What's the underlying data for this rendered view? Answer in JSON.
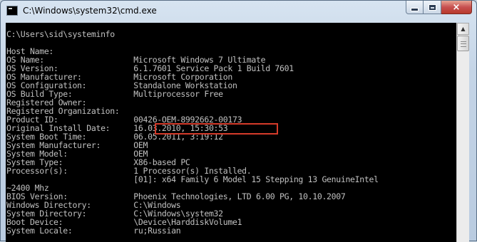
{
  "window": {
    "title": "C:\\Windows\\system32\\cmd.exe",
    "controls": {
      "minimize": "minimize",
      "maximize": "maximize",
      "close": "×"
    }
  },
  "console": {
    "lines": [
      "C:\\Users\\sid\\systeminfo",
      "",
      "Host Name:",
      "OS Name:                   Microsoft Windows 7 Ultimate",
      "OS Version:                6.1.7601 Service Pack 1 Build 7601",
      "OS Manufacturer:           Microsoft Corporation",
      "OS Configuration:          Standalone Workstation",
      "OS Build Type:             Multiprocessor Free",
      "Registered Owner:",
      "Registered Organization:",
      "Product ID:                00426-OEM-8992662-00173",
      "Original Install Date:     16.03.2010, 15:30:53",
      "System Boot Time:          06.05.2011, 3:19:12",
      "System Manufacturer:       OEM",
      "System Model:              OEM",
      "System Type:               X86-based PC",
      "Processor(s):              1 Processor(s) Installed.",
      "                           [01]: x64 Family 6 Model 15 Stepping 13 GenuineIntel",
      "~2400 Mhz",
      "BIOS Version:              Phoenix Technologies, LTD 6.00 PG, 10.10.2007",
      "Windows Directory:         C:\\Windows",
      "System Directory:          C:\\Windows\\system32",
      "Boot Device:               \\Device\\HarddiskVolume1",
      "System Locale:             ru;Russian"
    ]
  },
  "colors": {
    "console_background": "#000000",
    "console_text": "#c0c0c0",
    "highlight_border": "#d53b2a",
    "close_button": "#c75050"
  },
  "icons": {
    "app": "cmd-app-icon",
    "scroll_up": "scroll-up-arrow-icon"
  }
}
